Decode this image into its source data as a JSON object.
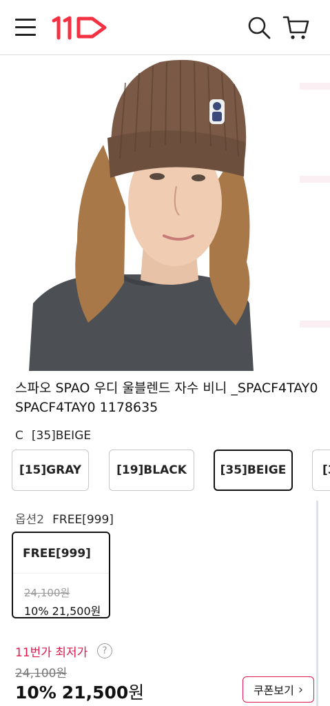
{
  "header": {
    "menu_icon": "hamburger-menu-icon",
    "logo_icon": "11st-logo",
    "brand_color": "#f43142",
    "search_icon": "search-icon",
    "cart_icon": "cart-icon"
  },
  "product": {
    "title": "스파오 SPAO 우디 울블렌드 자수 비니 _SPACF4TAY0 SPACF4TAY0 1178635"
  },
  "option1": {
    "label": "C",
    "selected_value": "[35]BEIGE",
    "choices": [
      "[15]GRAY",
      "[19]BLACK",
      "[35]BEIGE",
      "[3"
    ]
  },
  "option2": {
    "label": "옵션2",
    "selected_value": "FREE[999]",
    "card": {
      "name": "FREE[999]",
      "original_price": "24,100원",
      "sale_price": "10% 21,500원"
    }
  },
  "price": {
    "best_label": "11번가 최저가",
    "help": "?",
    "original": "24,100원",
    "discount": "10%",
    "final": "21,500",
    "currency": "원",
    "accent_color": "#e0174c"
  },
  "coupon": {
    "label": "쿠폰보기",
    "chevron": "›"
  }
}
